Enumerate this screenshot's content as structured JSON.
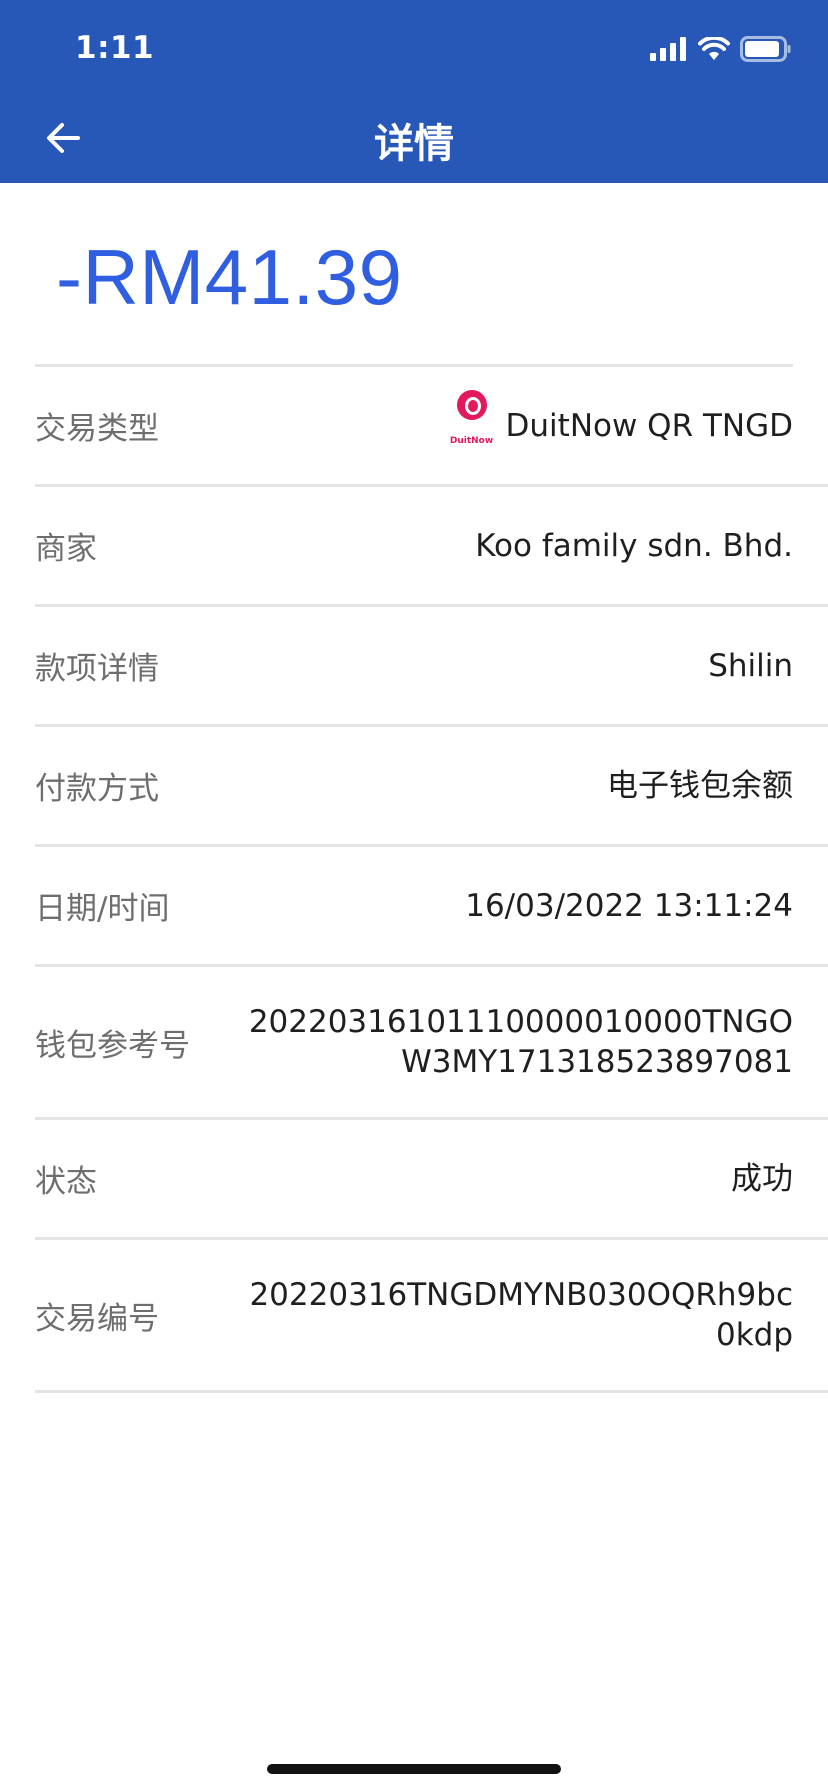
{
  "status_bar": {
    "time": "1:11"
  },
  "nav": {
    "title": "详情"
  },
  "amount": "-RM41.39",
  "details": {
    "transaction_type": {
      "label": "交易类型",
      "logo_text": "DuitNow",
      "value": "DuitNow QR TNGD"
    },
    "merchant": {
      "label": "商家",
      "value": "Koo family sdn. Bhd."
    },
    "payment_details": {
      "label": "款项详情",
      "value": "Shilin"
    },
    "payment_method": {
      "label": "付款方式",
      "value": "电子钱包余额"
    },
    "datetime": {
      "label": "日期/时间",
      "value": "16/03/2022 13:11:24"
    },
    "wallet_ref": {
      "label": "钱包参考号",
      "value": "20220316101110000010000TNGOW3MY171318523897081"
    },
    "status": {
      "label": "状态",
      "value": "成功"
    },
    "transaction_no": {
      "label": "交易编号",
      "value": "20220316TNGDMYNB030OQRh9bc0kdp"
    }
  },
  "colors": {
    "header_bg": "#2757b7",
    "amount": "#2f5fe0",
    "duitnow_brand": "#e21a5d"
  },
  "icons": {
    "back": "arrow-left-icon",
    "signal": "cellular-signal-icon",
    "wifi": "wifi-icon",
    "battery": "battery-icon"
  }
}
